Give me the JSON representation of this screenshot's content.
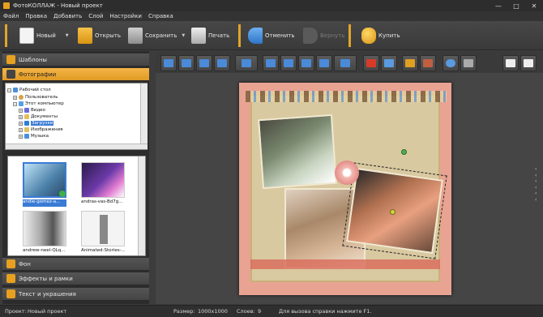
{
  "window": {
    "title": "ФотоКОЛЛАЖ - Новый проект",
    "min": "—",
    "max": "□",
    "close": "✕"
  },
  "menu": [
    "Файл",
    "Правка",
    "Добавить",
    "Слой",
    "Настройки",
    "Справка"
  ],
  "toolbar": {
    "new": "Новый",
    "open": "Открыть",
    "save": "Сохранить",
    "print": "Печать",
    "undo": "Отменить",
    "redo": "Вернуть",
    "buy": "Купить"
  },
  "panels": {
    "templates": "Шаблоны",
    "photos": "Фотографии",
    "background": "Фон",
    "effects": "Эффекты и рамки",
    "text": "Текст и украшения"
  },
  "tree": {
    "desktop": "Рабочий стол",
    "user": "Пользователь",
    "computer": "Этот компьютер",
    "video": "Видео",
    "documents": "Документы",
    "downloads": "Загрузки",
    "images": "Изображения",
    "music": "Музыка"
  },
  "thumbnails": [
    "andie-gomez-a...",
    "andras-vas-Bd7g...",
    "andrew-neel-QLq...",
    "Animated-Stories-..."
  ],
  "status": {
    "project_label": "Проект:",
    "project": "Новый проект",
    "size_label": "Размер:",
    "size": "1000x1000",
    "layers_label": "Слоев:",
    "layers": "9",
    "help": "Для вызова справки нажмите F1."
  },
  "colors": {
    "accent": "#e8a020",
    "selection": "#3a7bd5",
    "collage_bg": "#e9a392"
  }
}
